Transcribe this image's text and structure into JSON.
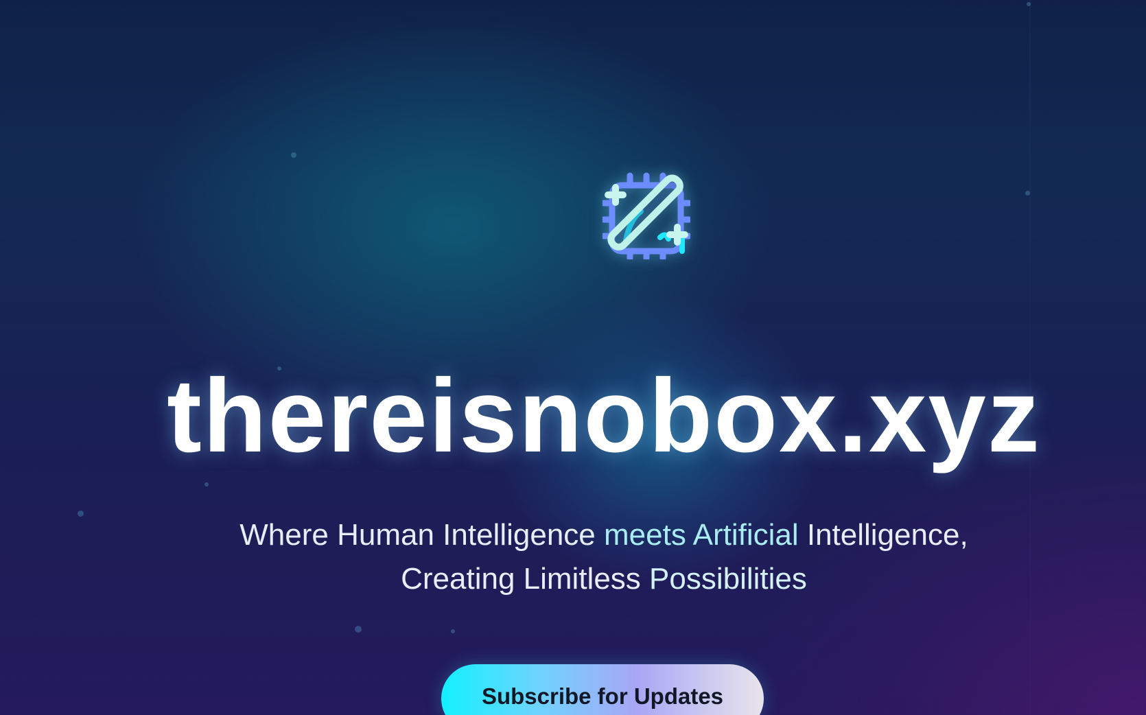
{
  "hero": {
    "logo_icon": "ai-magic-wand-icon",
    "title": "thereisnobox.xyz",
    "tagline": {
      "part1": "Where Human Intelligence ",
      "part2": "meets Artificial",
      "part3": " Intelligence,",
      "line2a": "Creating Limitless ",
      "line2b": "Possibilities"
    },
    "cta_label": "Subscribe for Updates"
  },
  "colors": {
    "background_top": "#0f2148",
    "background_bottom": "#241a5c",
    "teal_glow": "#0e607a",
    "accent_text": "#a9ecf2",
    "button_gradient_start": "#12f0ff",
    "button_gradient_end": "#e8e4ec"
  }
}
